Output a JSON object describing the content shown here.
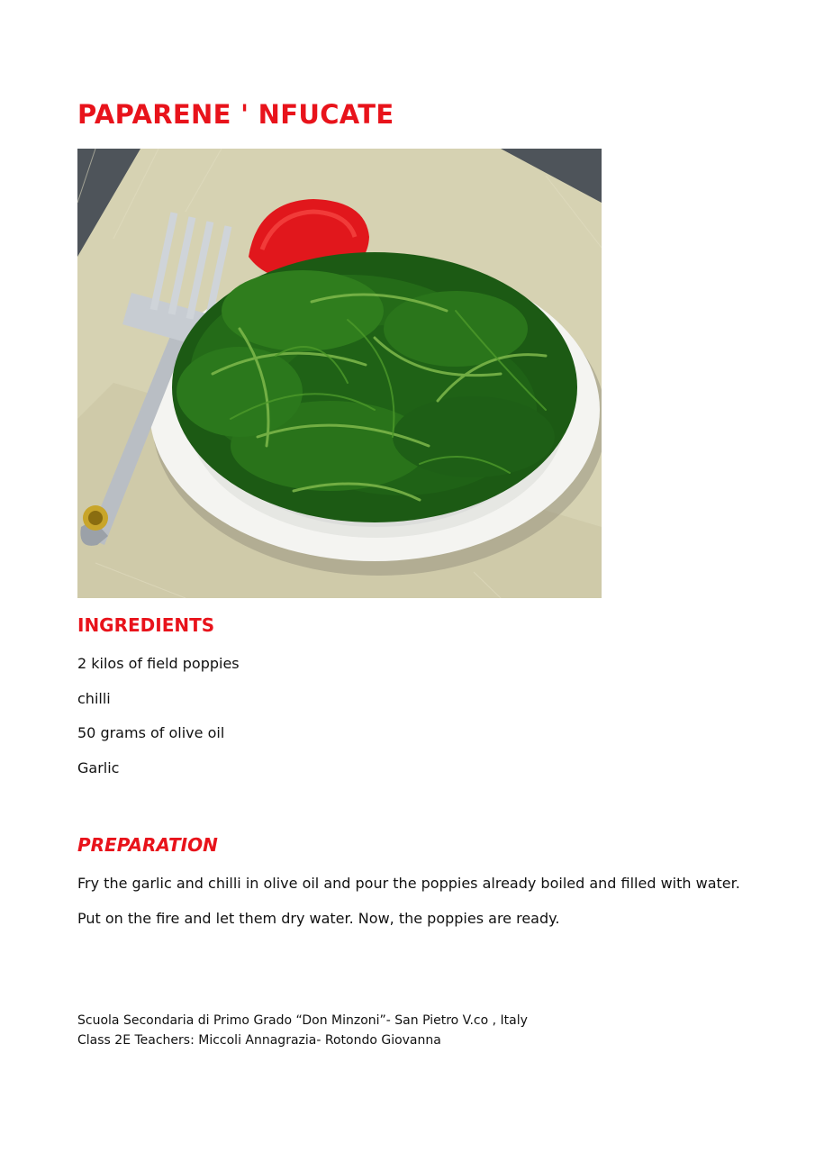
{
  "title": "PAPARENE ' NFUCATE",
  "photo": {
    "subject": "dish of sautéed field poppy greens on a white plate with a fork and a red chilli",
    "icon": "food-photo"
  },
  "ingredients": {
    "heading": "INGREDIENTS",
    "items": [
      "2 kilos of field poppies",
      "chilli",
      "50 grams of olive oil",
      "Garlic"
    ]
  },
  "preparation": {
    "heading": "PREPARATION",
    "steps": [
      "Fry the garlic and chilli in olive oil and pour the poppies already boiled and filled with water.",
      "Put on the fire and let them dry water. Now, the poppies are ready."
    ]
  },
  "footer": {
    "school": "Scuola Secondaria di Primo Grado “Don Minzoni”- San Pietro V.co , Italy",
    "class_line": "Class 2E  Teachers: Miccoli Annagrazia- Rotondo Giovanna"
  },
  "colors": {
    "heading_red": "#e8131b",
    "text": "#111111"
  }
}
